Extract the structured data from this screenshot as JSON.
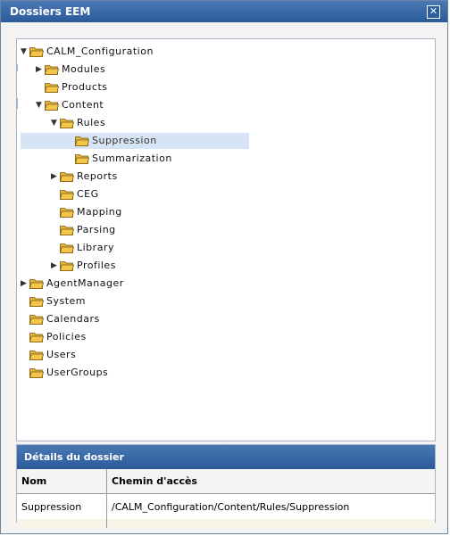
{
  "window": {
    "title": "Dossiers EEM",
    "close_glyph": "✕"
  },
  "tree": [
    {
      "label": "CALM_Configuration",
      "level": 0,
      "arrow": "down"
    },
    {
      "label": "Modules",
      "level": 1,
      "arrow": "right"
    },
    {
      "label": "Products",
      "level": 1,
      "arrow": "none"
    },
    {
      "label": "Content",
      "level": 1,
      "arrow": "down"
    },
    {
      "label": "Rules",
      "level": 2,
      "arrow": "down"
    },
    {
      "label": "Suppression",
      "level": 3,
      "arrow": "none",
      "selected": true
    },
    {
      "label": "Summarization",
      "level": 3,
      "arrow": "none"
    },
    {
      "label": "Reports",
      "level": 2,
      "arrow": "right"
    },
    {
      "label": "CEG",
      "level": 2,
      "arrow": "none"
    },
    {
      "label": "Mapping",
      "level": 2,
      "arrow": "none"
    },
    {
      "label": "Parsing",
      "level": 2,
      "arrow": "none"
    },
    {
      "label": "Library",
      "level": 2,
      "arrow": "none"
    },
    {
      "label": "Profiles",
      "level": 2,
      "arrow": "right"
    },
    {
      "label": "AgentManager",
      "level": 0,
      "arrow": "right"
    },
    {
      "label": "System",
      "level": 0,
      "arrow": "none"
    },
    {
      "label": "Calendars",
      "level": 0,
      "arrow": "none"
    },
    {
      "label": "Policies",
      "level": 0,
      "arrow": "none"
    },
    {
      "label": "Users",
      "level": 0,
      "arrow": "none"
    },
    {
      "label": "UserGroups",
      "level": 0,
      "arrow": "none"
    }
  ],
  "details": {
    "header": "Détails du dossier",
    "columns": [
      "Nom",
      "Chemin d'accès"
    ],
    "row": {
      "name": "Suppression",
      "path": "/CALM_Configuration/Content/Rules/Suppression"
    }
  },
  "colors": {
    "titlebar": "#3a6aa8",
    "selection": "#d6e4f6",
    "folder": "#f3c64a"
  }
}
